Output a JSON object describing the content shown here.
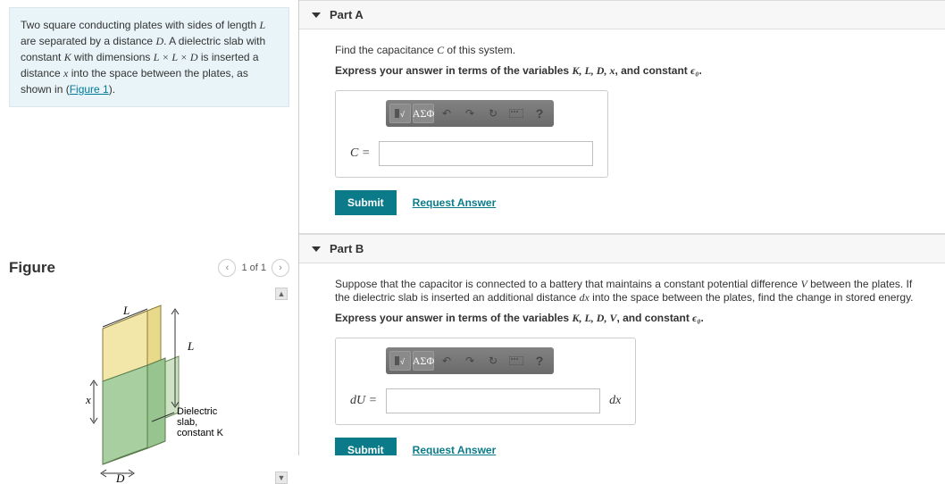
{
  "problem": {
    "text_pre": "Two square conducting plates with sides of length ",
    "L": "L",
    "text_1": " are separated by a distance ",
    "D": "D",
    "text_2": ". A dielectric slab with constant ",
    "K": "K",
    "text_3": " with dimensions ",
    "dims": "L × L × D",
    "text_4": " is inserted a distance ",
    "x": "x",
    "text_5": " into the space between the plates, as shown in (",
    "fig_link": "Figure 1",
    "text_6": ")."
  },
  "figure": {
    "title": "Figure",
    "counter": "1 of 1",
    "label_L1": "L",
    "label_L2": "L",
    "label_x": "x",
    "label_D": "D",
    "caption1": "Dielectric",
    "caption2": "slab,",
    "caption3": "constant K"
  },
  "partA": {
    "title": "Part A",
    "prompt_pre": "Find the capacitance ",
    "C": "C",
    "prompt_post": " of this system.",
    "express_pre": "Express your answer in terms of the variables ",
    "vars": "K, L, D, x",
    "express_mid": ", and constant ",
    "eps": "ϵ₀",
    "express_post": ".",
    "toolbar_greek": "ΑΣΦ",
    "eq_label": "C",
    "submit": "Submit",
    "request": "Request Answer"
  },
  "partB": {
    "title": "Part B",
    "prompt_pre": "Suppose that the capacitor is connected to a battery that maintains a constant potential difference ",
    "V": "V",
    "prompt_mid": " between the plates. If the dielectric slab is inserted an additional distance ",
    "dx": "dx",
    "prompt_post": " into the space between the plates, find the change in stored energy.",
    "express_pre": "Express your answer in terms of the variables ",
    "vars": "K, L, D, V",
    "express_mid": ", and constant ",
    "eps": "ϵ₀",
    "express_post": ".",
    "toolbar_greek": "ΑΣΦ",
    "eq_label": "dU",
    "eq_suffix": "dx",
    "submit": "Submit",
    "request": "Request Answer"
  }
}
